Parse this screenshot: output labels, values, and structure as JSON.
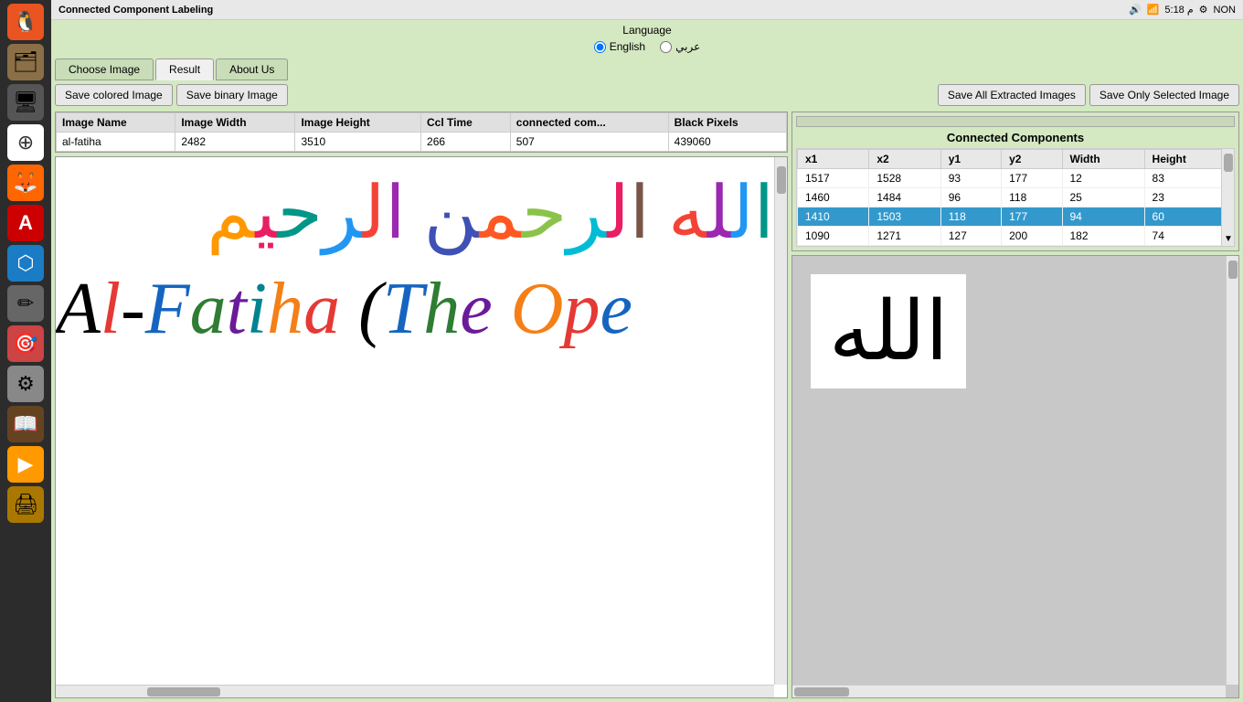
{
  "window": {
    "title": "Connected Component Labeling"
  },
  "topbar": {
    "time": "5:18 م",
    "locale": "NON"
  },
  "language": {
    "label": "Language",
    "options": [
      {
        "id": "en",
        "label": "English",
        "selected": true
      },
      {
        "id": "ar",
        "label": "عربي",
        "selected": false
      }
    ]
  },
  "tabs": [
    {
      "id": "choose-image",
      "label": "Choose Image",
      "active": false
    },
    {
      "id": "result",
      "label": "Result",
      "active": true
    },
    {
      "id": "about-us",
      "label": "About Us",
      "active": false
    }
  ],
  "buttons": {
    "save_colored": "Save colored Image",
    "save_binary": "Save binary Image",
    "save_extracted": "Save All Extracted Images",
    "save_selected": "Save Only Selected Image"
  },
  "table": {
    "headers": [
      "Image Name",
      "Image Width",
      "Image Height",
      "Ccl Time",
      "connected com...",
      "Black Pixels"
    ],
    "rows": [
      {
        "name": "al-fatiha",
        "width": "2482",
        "height": "3510",
        "ccl_time": "266",
        "connected": "507",
        "black_pixels": "439060"
      }
    ]
  },
  "cc_panel": {
    "title": "Connected Components",
    "headers": [
      "x1",
      "x2",
      "y1",
      "y2",
      "Width",
      "Height"
    ],
    "rows": [
      {
        "x1": "1517",
        "x2": "1528",
        "y1": "93",
        "y2": "177",
        "width": "12",
        "height": "83",
        "selected": false
      },
      {
        "x1": "1460",
        "x2": "1484",
        "y1": "96",
        "y2": "118",
        "width": "25",
        "height": "23",
        "selected": false
      },
      {
        "x1": "1410",
        "x2": "1503",
        "y1": "118",
        "y2": "177",
        "width": "94",
        "height": "60",
        "selected": true
      },
      {
        "x1": "1090",
        "x2": "1271",
        "y1": "127",
        "y2": "200",
        "width": "182",
        "height": "74",
        "selected": false
      }
    ]
  },
  "preview": {
    "arabic_text": "الله"
  }
}
